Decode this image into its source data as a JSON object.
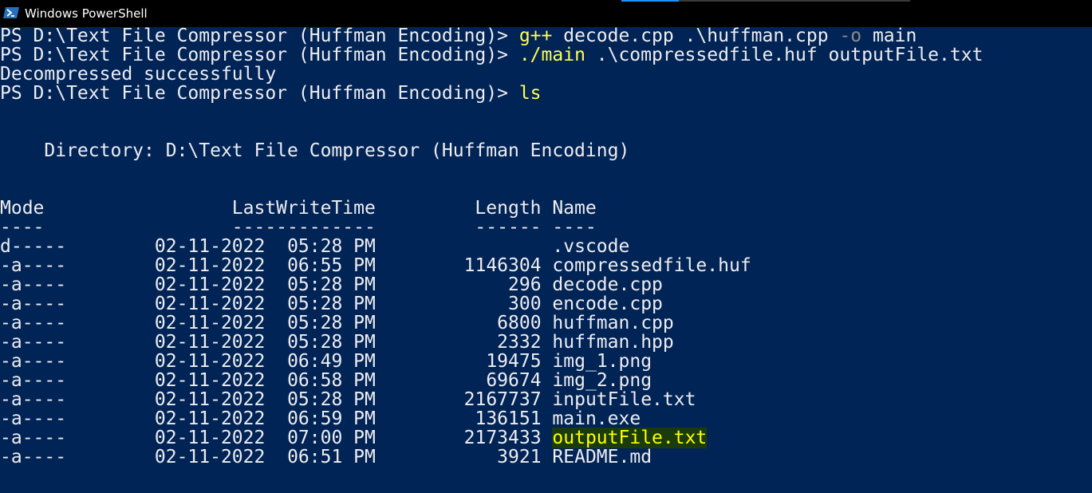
{
  "window": {
    "title": "Windows PowerShell",
    "icon": "powershell-icon",
    "colors": {
      "background": "#012456",
      "foreground": "#eeedf0",
      "command": "#ffff55",
      "parameter": "#8a8a8a",
      "highlight_bg": "#1a3b0c",
      "highlight_fg": "#ffff00"
    }
  },
  "session": {
    "prompt": "PS D:\\Text File Compressor (Huffman Encoding)> ",
    "commands": [
      {
        "command": "g++",
        "args_before": " decode.cpp .\\huffman.cpp ",
        "param": "-o",
        "args_after": " main"
      },
      {
        "command": "./main",
        "args_before": " .\\compressedfile.huf outputFile.txt",
        "param": "",
        "args_after": ""
      }
    ],
    "output_message": "Decompressed successfully",
    "ls_command": "ls"
  },
  "listing": {
    "directory_line": "    Directory: D:\\Text File Compressor (Huffman Encoding)",
    "header_line": "Mode                 LastWriteTime         Length Name",
    "separator_line": "----                 -------------         ------ ----",
    "rows": [
      {
        "mode": "d-----",
        "date": "02-11-2022",
        "time": "05:28 PM",
        "length": "",
        "name": ".vscode"
      },
      {
        "mode": "-a----",
        "date": "02-11-2022",
        "time": "06:55 PM",
        "length": "1146304",
        "name": "compressedfile.huf"
      },
      {
        "mode": "-a----",
        "date": "02-11-2022",
        "time": "05:28 PM",
        "length": "296",
        "name": "decode.cpp"
      },
      {
        "mode": "-a----",
        "date": "02-11-2022",
        "time": "05:28 PM",
        "length": "300",
        "name": "encode.cpp"
      },
      {
        "mode": "-a----",
        "date": "02-11-2022",
        "time": "05:28 PM",
        "length": "6800",
        "name": "huffman.cpp"
      },
      {
        "mode": "-a----",
        "date": "02-11-2022",
        "time": "05:28 PM",
        "length": "2332",
        "name": "huffman.hpp"
      },
      {
        "mode": "-a----",
        "date": "02-11-2022",
        "time": "06:49 PM",
        "length": "19475",
        "name": "img_1.png"
      },
      {
        "mode": "-a----",
        "date": "02-11-2022",
        "time": "06:58 PM",
        "length": "69674",
        "name": "img_2.png"
      },
      {
        "mode": "-a----",
        "date": "02-11-2022",
        "time": "05:28 PM",
        "length": "2167737",
        "name": "inputFile.txt"
      },
      {
        "mode": "-a----",
        "date": "02-11-2022",
        "time": "06:59 PM",
        "length": "136151",
        "name": "main.exe"
      },
      {
        "mode": "-a----",
        "date": "02-11-2022",
        "time": "07:00 PM",
        "length": "2173433",
        "name": "outputFile.txt",
        "highlighted": true
      },
      {
        "mode": "-a----",
        "date": "02-11-2022",
        "time": "06:51 PM",
        "length": "3921",
        "name": "README.md"
      }
    ]
  }
}
